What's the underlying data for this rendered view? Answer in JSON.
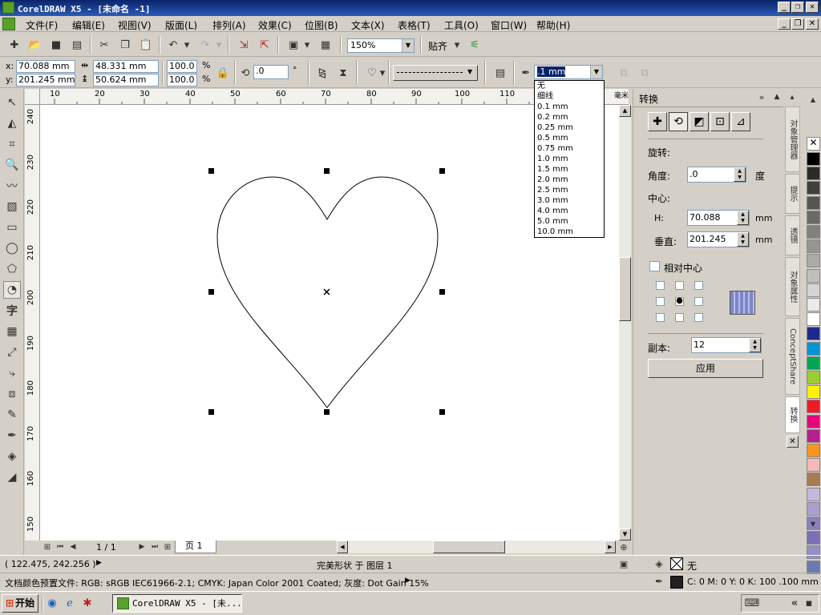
{
  "title": {
    "text": "CorelDRAW X5 - [未命名 -1]"
  },
  "menu": [
    "文件(F)",
    "编辑(E)",
    "视图(V)",
    "版面(L)",
    "排列(A)",
    "效果(C)",
    "位图(B)",
    "文本(X)",
    "表格(T)",
    "工具(O)",
    "窗口(W)",
    "帮助(H)"
  ],
  "toolbar": {
    "zoom": "150%",
    "snap": "贴齐"
  },
  "props": {
    "x": "70.088 mm",
    "y": "201.245 mm",
    "w": "48.331 mm",
    "h": "50.624 mm",
    "scale_x": "100.0",
    "scale_y": "100.0",
    "pct": "%",
    "angle": ".0",
    "deg": "°",
    "outline_width": ".1 mm"
  },
  "outline_options": [
    "无",
    "细线",
    "0.1 mm",
    "0.2 mm",
    "0.25 mm",
    "0.5 mm",
    "0.75 mm",
    "1.0 mm",
    "1.5 mm",
    "2.0 mm",
    "2.5 mm",
    "3.0 mm",
    "4.0 mm",
    "5.0 mm",
    "10.0 mm"
  ],
  "ruler": {
    "h_ticks": [
      "10",
      "20",
      "30",
      "40",
      "50",
      "60",
      "70",
      "80",
      "90",
      "100",
      "110"
    ],
    "h_unit": "毫米",
    "v_ticks": [
      "240",
      "230",
      "220",
      "210",
      "200",
      "190",
      "180",
      "170",
      "160",
      "150"
    ]
  },
  "pages": {
    "counter": "1 / 1",
    "tab": "页 1"
  },
  "docker": {
    "title": "转换",
    "rotate_label": "旋转:",
    "angle_label": "角度:",
    "angle_value": ".0",
    "angle_unit": "度",
    "center_label": "中心:",
    "h_label": "H:",
    "h_value": "70.088",
    "h_unit": "mm",
    "v_label": "垂直:",
    "v_value": "201.245",
    "v_unit": "mm",
    "relative_center": "相对中心",
    "copies_label": "副本:",
    "copies_value": "12",
    "apply": "应用"
  },
  "side_tabs": [
    "对象管理器",
    "提示",
    "透镜",
    "对象属性",
    "ConceptShare",
    "转换"
  ],
  "palette": [
    "#ffffff",
    "#000000",
    "#2b2b2b",
    "#404040",
    "#555555",
    "#6a6a6a",
    "#808080",
    "#959595",
    "#aaaaaa",
    "#bfbfbf",
    "#d5d5d5",
    "#eaeaea",
    "#ffffff",
    "#1f2a8f",
    "#0095d5",
    "#00a651",
    "#9acd32",
    "#fff200",
    "#ed1c24",
    "#e6007e",
    "#b5218e",
    "#f7941d",
    "#f4b9b9",
    "#a67c52",
    "#c6b8dc",
    "#a99fd0",
    "#8c7fc0",
    "#7a6fb5",
    "#9391c4",
    "#687bb0"
  ],
  "status": {
    "coords": "( 122.475, 242.256 )",
    "shape_info": "完美形状 于 图层 1",
    "fill_none": "无",
    "color_profile": "文档颜色预置文件: RGB: sRGB IEC61966-2.1; CMYK: Japan Color 2001 Coated; 灰度: Dot Gain 15%",
    "outline_info": "C: 0 M: 0 Y: 0 K: 100  .100 mm"
  },
  "taskbar": {
    "start": "开始",
    "task": "CorelDRAW X5 - [未..."
  }
}
